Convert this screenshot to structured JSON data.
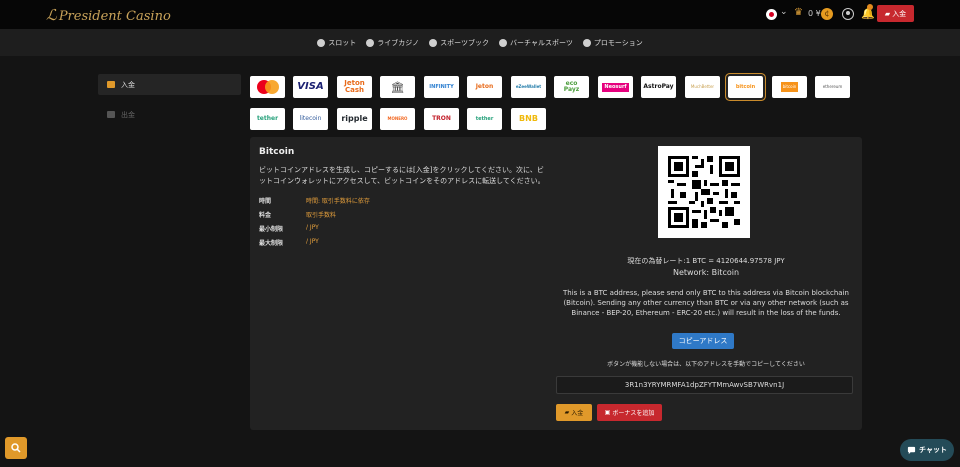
{
  "header": {
    "logo_mark": "ℒ",
    "logo_text": "President Casino",
    "chevron": "⌄",
    "crown": "♛",
    "balance": "0 ¥",
    "coin_symbol": "¢",
    "bell": "🔔",
    "deposit_label": "入金"
  },
  "nav": {
    "items": [
      {
        "label": "スロット",
        "icon": "slot-icon"
      },
      {
        "label": "ライブカジノ",
        "icon": "live-casino-icon"
      },
      {
        "label": "スポーツブック",
        "icon": "sportsbook-icon"
      },
      {
        "label": "バーチャルスポーツ",
        "icon": "virtual-sports-icon"
      },
      {
        "label": "プロモーション",
        "icon": "promotion-icon"
      }
    ]
  },
  "sidebar": {
    "deposit_label": "入金",
    "withdraw_label": "出金"
  },
  "methods": [
    {
      "id": "mastercard",
      "label": ""
    },
    {
      "id": "visa",
      "label": "VISA"
    },
    {
      "id": "jetoncash",
      "label": "Jeton Cash"
    },
    {
      "id": "bank",
      "label": "🏛"
    },
    {
      "id": "infinity",
      "label": "INFINITY"
    },
    {
      "id": "jeton",
      "label": "Jeton"
    },
    {
      "id": "ezeewallet",
      "label": "eZeeWallet"
    },
    {
      "id": "ecopayz",
      "label": "eco Payz"
    },
    {
      "id": "neosurf",
      "label": "Neosurf"
    },
    {
      "id": "astropay",
      "label": "AstroPay"
    },
    {
      "id": "muchbetter",
      "label": "MuchBetter"
    },
    {
      "id": "bitcoin",
      "label": "bitcoin"
    },
    {
      "id": "bitcoincash",
      "label": "bitcoin"
    },
    {
      "id": "ethereum",
      "label": "ethereum"
    },
    {
      "id": "tether",
      "label": "tether"
    },
    {
      "id": "litecoin",
      "label": "litecoin"
    },
    {
      "id": "ripple",
      "label": "ripple"
    },
    {
      "id": "monero",
      "label": "MONERO"
    },
    {
      "id": "tron",
      "label": "TRON"
    },
    {
      "id": "tethererc",
      "label": "tether"
    },
    {
      "id": "bnb",
      "label": "BNB"
    }
  ],
  "panel": {
    "title": "Bitcoin",
    "description": "ビットコインアドレスを生成し、コピーするには[入金]をクリックしてください。次に、ビットコインウォレットにアクセスして、ビットコインをそのアドレスに転送してください。",
    "info": [
      {
        "label": "時間",
        "value": "時間: 取引手数料に依存"
      },
      {
        "label": "料金",
        "value": "取引手数料"
      },
      {
        "label": "最小制限",
        "value": "/ JPY"
      },
      {
        "label": "最大制限",
        "value": "/ JPY"
      }
    ],
    "rate": "現在の為替レート:1 BTC = 4120644.97578 JPY",
    "network": "Network: Bitcoin",
    "warning": "This is a BTC address, please send only BTC to this address via Bitcoin blockchain (Bitcoin). Sending any other currency than BTC or via any other network (such as Binance - BEP-20, Ethereum - ERC-20 etc.) will result in the loss of the funds.",
    "copy_button": "コピーアドレス",
    "manual_note": "ボタンが機能しない場合は、以下のアドレスを手動でコピーしてください",
    "address": "3R1n3YRYMRMFA1dpZFYTMmAwvSB7WRvn1J",
    "deposit_button": "入金",
    "bonus_button": "ボーナスを追加"
  },
  "chat_label": "チャット"
}
